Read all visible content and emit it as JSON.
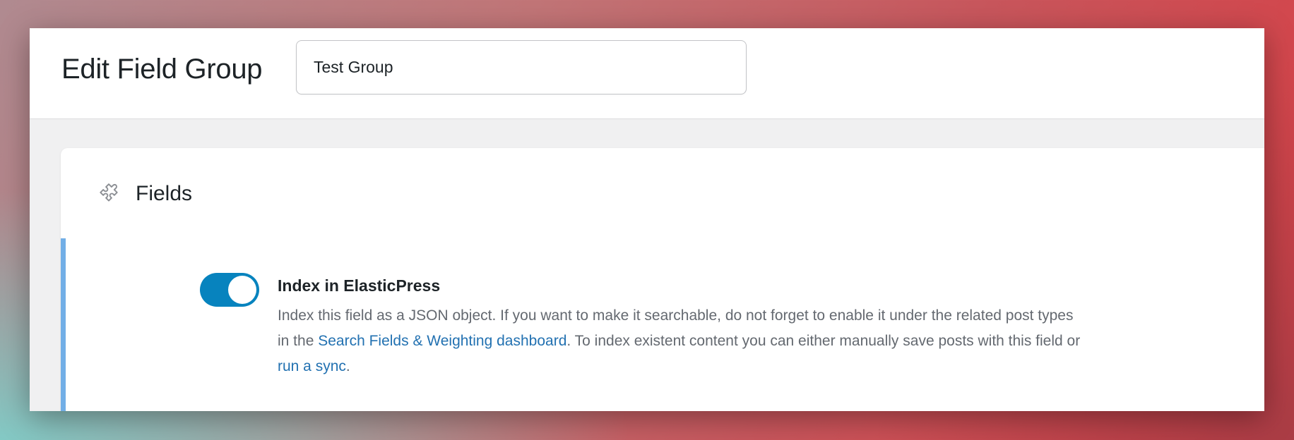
{
  "header": {
    "title": "Edit Field Group",
    "group_name_value": "Test Group"
  },
  "fields_panel": {
    "title": "Fields",
    "icon": "puzzle-icon"
  },
  "setting": {
    "toggle_on": true,
    "label": "Index in ElasticPress",
    "desc_part1": "Index this field as a JSON object. If you want to make it searchable, do not forget to enable it under the related post types in the ",
    "link1": "Search Fields & Weighting dashboard",
    "desc_part2": ". To index existent content you can either manually save posts with this field or ",
    "link2": "run a sync",
    "desc_part3": "."
  },
  "colors": {
    "accent": "#0783be",
    "link": "#2271b1",
    "field_border": "#72aee6"
  }
}
